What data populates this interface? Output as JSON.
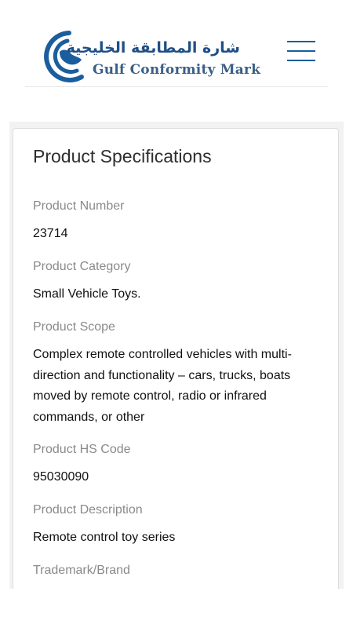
{
  "header": {
    "logo_arabic": "شارة المطابقة الخليجية",
    "logo_english": "Gulf Conformity Mark",
    "brand_color": "#1a5e9e",
    "menu_icon": "hamburger-menu-icon"
  },
  "card": {
    "title": "Product Specifications",
    "fields": [
      {
        "label": "Product Number",
        "value": "23714"
      },
      {
        "label": "Product Category",
        "value": "Small Vehicle Toys."
      },
      {
        "label": "Product Scope",
        "value": "Complex remote controlled vehicles with multi-direction and functionality – cars, trucks, boats moved by remote control, radio or infrared commands, or other"
      },
      {
        "label": "Product HS Code",
        "value": "95030090"
      },
      {
        "label": "Product Description",
        "value": "Remote control toy series"
      },
      {
        "label": "Trademark/Brand",
        "value": ""
      }
    ]
  }
}
